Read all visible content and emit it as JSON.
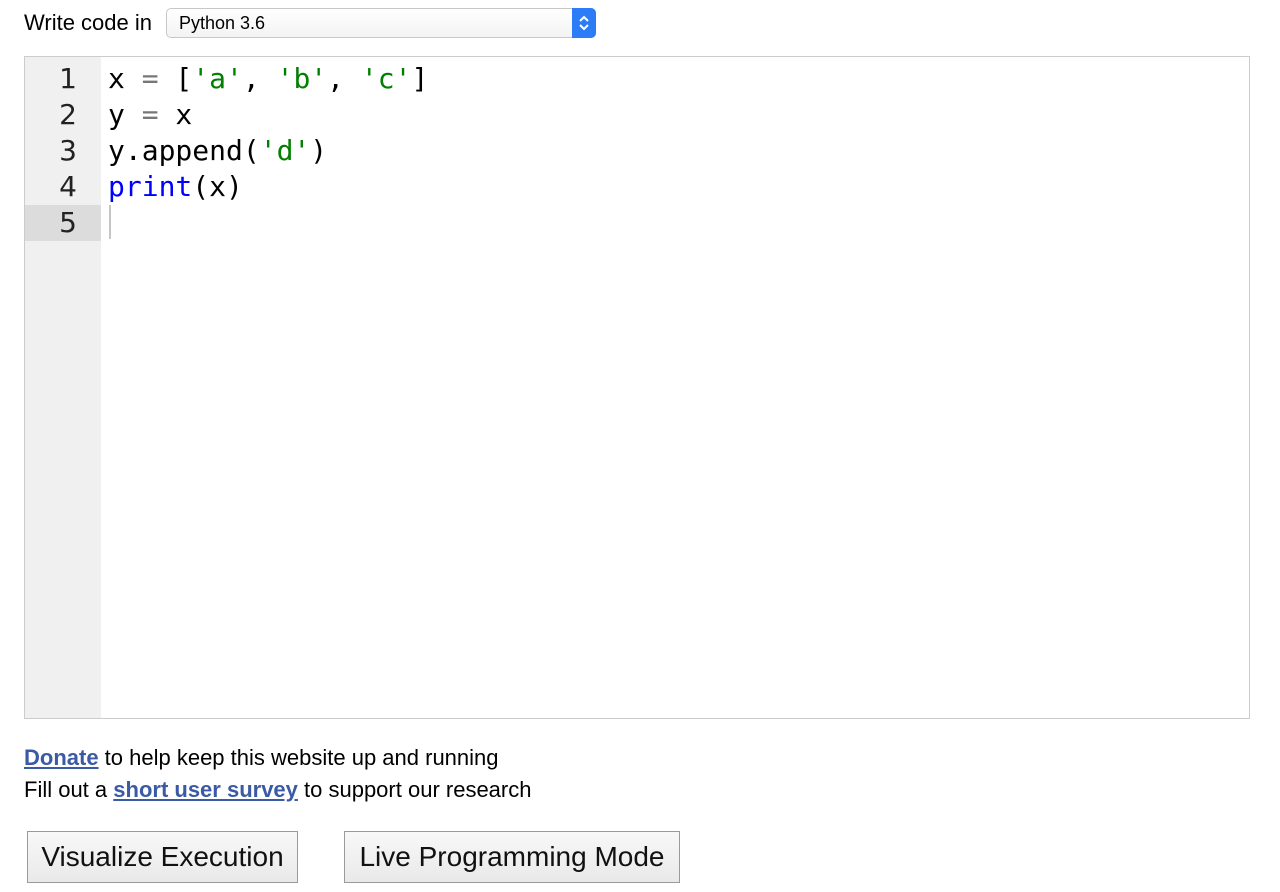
{
  "header": {
    "label": "Write code in",
    "language_select": {
      "value": "Python 3.6",
      "icon": "updown-chevron-icon"
    }
  },
  "editor": {
    "line_numbers": [
      "1",
      "2",
      "3",
      "4",
      "5"
    ],
    "active_line": 5,
    "lines": [
      [
        {
          "t": "x ",
          "k": "plain"
        },
        {
          "t": "=",
          "k": "op"
        },
        {
          "t": " [",
          "k": "plain"
        },
        {
          "t": "'a'",
          "k": "str"
        },
        {
          "t": ", ",
          "k": "plain"
        },
        {
          "t": "'b'",
          "k": "str"
        },
        {
          "t": ", ",
          "k": "plain"
        },
        {
          "t": "'c'",
          "k": "str"
        },
        {
          "t": "]",
          "k": "plain"
        }
      ],
      [
        {
          "t": "y ",
          "k": "plain"
        },
        {
          "t": "=",
          "k": "op"
        },
        {
          "t": " x",
          "k": "plain"
        }
      ],
      [
        {
          "t": "y.append(",
          "k": "plain"
        },
        {
          "t": "'d'",
          "k": "str"
        },
        {
          "t": ")",
          "k": "plain"
        }
      ],
      [
        {
          "t": "print",
          "k": "kw"
        },
        {
          "t": "(x)",
          "k": "plain"
        }
      ],
      []
    ],
    "colors": {
      "string": "#008000",
      "keyword": "#0000ff",
      "operator": "#777777",
      "gutter_bg": "#f0f0f0"
    }
  },
  "notes": {
    "donate_link": "Donate",
    "donate_text": " to help keep this website up and running",
    "survey_prefix": "Fill out a ",
    "survey_link": "short user survey",
    "survey_suffix": " to support our research",
    "link_color": "#3b5aa6"
  },
  "buttons": {
    "visualize": "Visualize Execution",
    "live": "Live Programming Mode"
  }
}
